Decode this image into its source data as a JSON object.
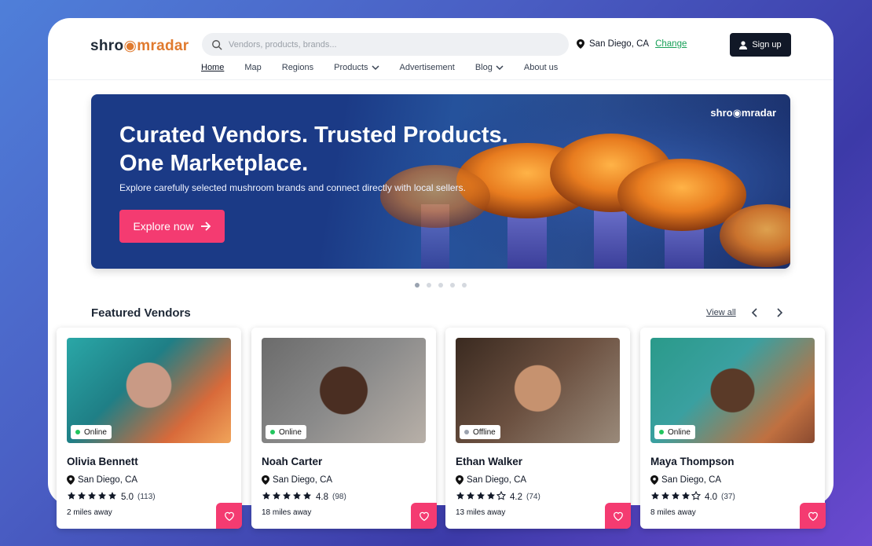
{
  "brand": {
    "logo_pre": "shro",
    "logo_post": "mradar",
    "hero_logo": "shro◉mradar"
  },
  "search": {
    "placeholder": "Vendors, products, brands..."
  },
  "location": {
    "city": "San Diego, CA",
    "change_label": "Change"
  },
  "signup_label": "Sign up",
  "nav": [
    {
      "label": "Home",
      "active": true
    },
    {
      "label": "Map"
    },
    {
      "label": "Regions"
    },
    {
      "label": "Products",
      "dropdown": true
    },
    {
      "label": "Advertisement"
    },
    {
      "label": "Blog",
      "dropdown": true
    },
    {
      "label": "About us"
    }
  ],
  "hero": {
    "title_line1": "Curated Vendors. Trusted Products.",
    "title_line2": "One Marketplace.",
    "subtitle": "Explore carefully selected mushroom brands and connect directly with local sellers.",
    "cta": "Explore now"
  },
  "carousel": {
    "count": 5,
    "active": 0
  },
  "featured": {
    "title": "Featured Vendors",
    "view_all": "View all",
    "vendors": [
      {
        "name": "Olivia Bennett",
        "location": "San Diego, CA",
        "rating": "5.0",
        "reviews": "(113)",
        "distance": "2 miles away",
        "status": "Online",
        "stars": 5
      },
      {
        "name": "Noah Carter",
        "location": "San Diego, CA",
        "rating": "4.8",
        "reviews": "(98)",
        "distance": "18 miles away",
        "status": "Online",
        "stars": 5
      },
      {
        "name": "Ethan Walker",
        "location": "San Diego, CA",
        "rating": "4.2",
        "reviews": "(74)",
        "distance": "13 miles away",
        "status": "Offline",
        "stars": 4
      },
      {
        "name": "Maya Thompson",
        "location": "San Diego, CA",
        "rating": "4.0",
        "reviews": "(37)",
        "distance": "8 miles away",
        "status": "Online",
        "stars": 4
      }
    ]
  },
  "colors": {
    "accent": "#f43b71",
    "online": "#22c55e",
    "offline": "#9ca3af",
    "brand_orange": "#e07a2e",
    "link_green": "#18a058"
  }
}
